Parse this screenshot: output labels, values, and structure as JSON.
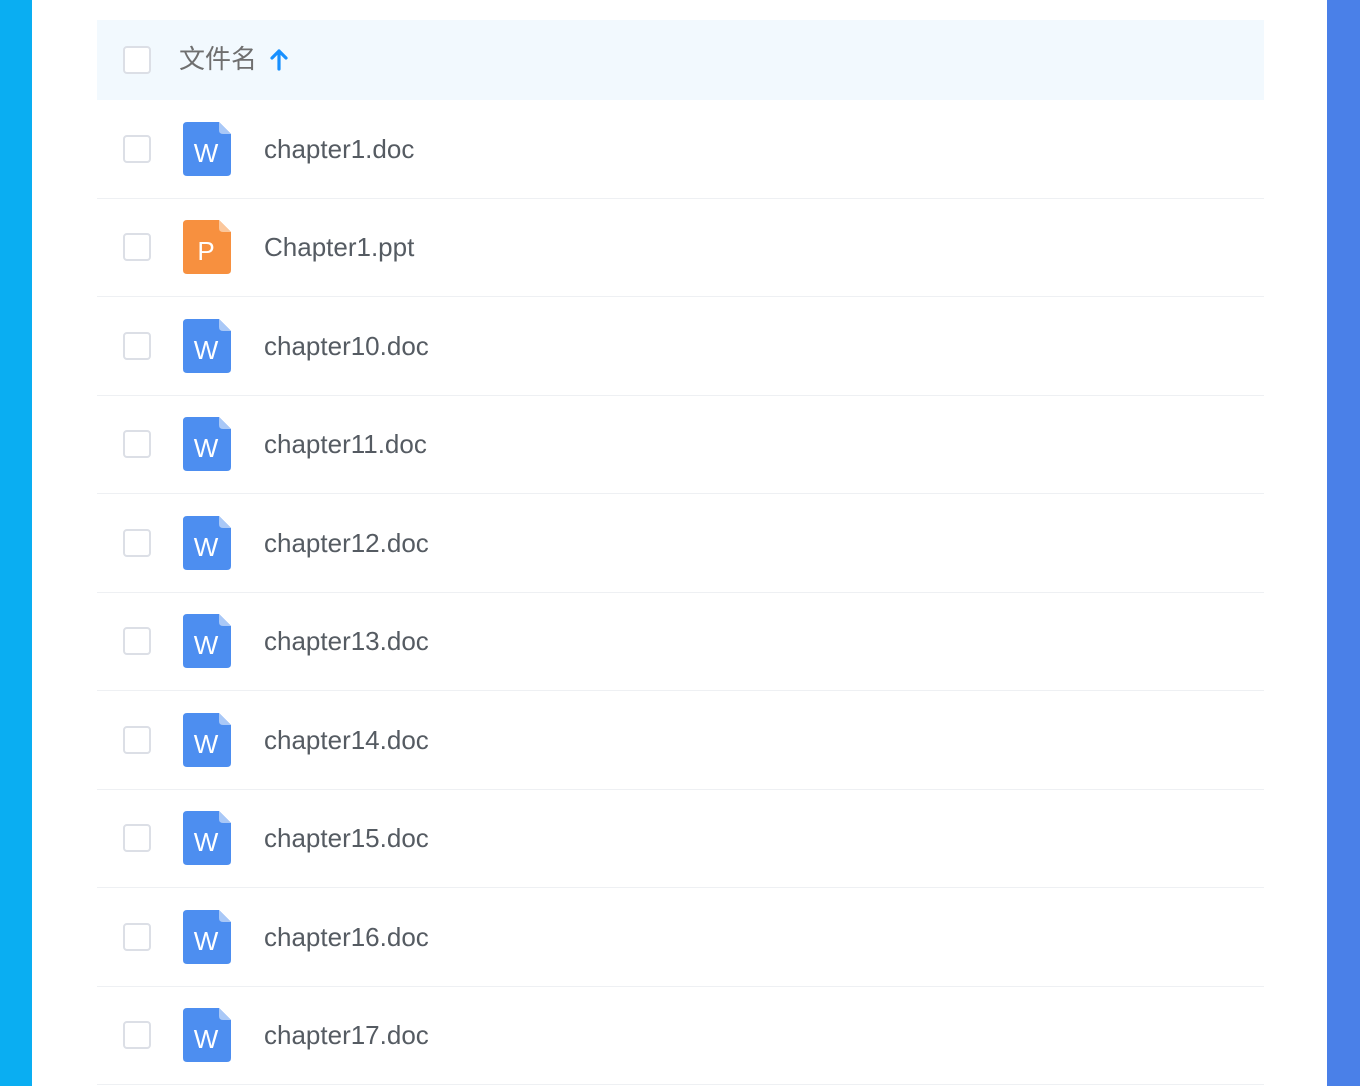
{
  "colors": {
    "left_bar": "#0aaef2",
    "right_bar": "#4a80e8",
    "header_bg": "#f2f9fe",
    "header_text": "#6f6f6f",
    "sort_arrow": "#1890ff",
    "file_text": "#555b62",
    "doc_icon": "#4d8ef0",
    "doc_icon_fold": "#a9c8f7",
    "ppt_icon": "#f7903f",
    "ppt_icon_fold": "#fbc79c"
  },
  "header": {
    "label": "文件名",
    "sort_icon": "arrow-up-icon"
  },
  "files": [
    {
      "name": "chapter1.doc",
      "type": "doc",
      "letter": "W",
      "icon": "word-file-icon"
    },
    {
      "name": "Chapter1.ppt",
      "type": "ppt",
      "letter": "P",
      "icon": "powerpoint-file-icon"
    },
    {
      "name": "chapter10.doc",
      "type": "doc",
      "letter": "W",
      "icon": "word-file-icon"
    },
    {
      "name": "chapter11.doc",
      "type": "doc",
      "letter": "W",
      "icon": "word-file-icon"
    },
    {
      "name": "chapter12.doc",
      "type": "doc",
      "letter": "W",
      "icon": "word-file-icon"
    },
    {
      "name": "chapter13.doc",
      "type": "doc",
      "letter": "W",
      "icon": "word-file-icon"
    },
    {
      "name": "chapter14.doc",
      "type": "doc",
      "letter": "W",
      "icon": "word-file-icon"
    },
    {
      "name": "chapter15.doc",
      "type": "doc",
      "letter": "W",
      "icon": "word-file-icon"
    },
    {
      "name": "chapter16.doc",
      "type": "doc",
      "letter": "W",
      "icon": "word-file-icon"
    },
    {
      "name": "chapter17.doc",
      "type": "doc",
      "letter": "W",
      "icon": "word-file-icon"
    }
  ]
}
